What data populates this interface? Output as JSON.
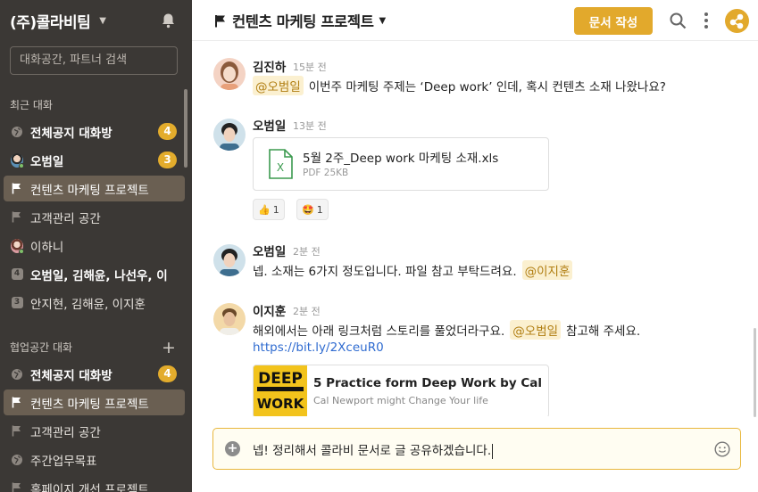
{
  "sidebar": {
    "workspace": "(주)콜라비팀",
    "search_placeholder": "대화공간, 파트너 검색",
    "recent_label": "최근 대화",
    "recent_items": [
      {
        "label": "전체공지 대화방",
        "icon": "globe-icon",
        "badge": "4",
        "bold": true
      },
      {
        "label": "오범일",
        "icon": "avatar",
        "badge": "3",
        "bold": true
      },
      {
        "label": "컨텐츠 마케팅 프로젝트",
        "icon": "flag-icon",
        "active": true
      },
      {
        "label": "고객관리 공간",
        "icon": "flag-icon"
      },
      {
        "label": "이하니",
        "icon": "avatar"
      },
      {
        "label": "오범일, 김해윤, 나선우, 이",
        "icon": "number-icon",
        "num": "4",
        "bold": true
      },
      {
        "label": "안지현, 김해윤, 이지훈",
        "icon": "number-icon",
        "num": "3"
      }
    ],
    "collab_label": "협업공간 대화",
    "collab_items": [
      {
        "label": "전체공지 대화방",
        "icon": "globe-icon",
        "badge": "4",
        "bold": true
      },
      {
        "label": "컨텐츠 마케팅 프로젝트",
        "icon": "flag-icon",
        "active": true
      },
      {
        "label": "고객관리 공간",
        "icon": "flag-icon"
      },
      {
        "label": "주간업무목표",
        "icon": "globe-icon"
      },
      {
        "label": "홈페이지 개선 프로젝트",
        "icon": "flag-icon"
      }
    ]
  },
  "header": {
    "title": "컨텐츠 마케팅 프로젝트",
    "write_button": "문서 작성"
  },
  "messages": [
    {
      "author": "김진하",
      "time": "15분 전",
      "mention": "@오범일",
      "text": "이번주 마케팅 주제는 ‘Deep work’ 인데, 혹시 컨텐츠 소재 나왔나요?"
    },
    {
      "author": "오범일",
      "time": "13분 전",
      "file": {
        "name": "5월 2주_Deep work 마케팅 소재.xls",
        "meta": "PDF  25KB"
      },
      "reactions": [
        {
          "emoji": "👍",
          "count": "1"
        },
        {
          "emoji": "🤩",
          "count": "1"
        }
      ]
    },
    {
      "author": "오범일",
      "time": "2분 전",
      "text": "넵. 소재는 6가지 정도입니다. 파일 참고 부탁드려요.",
      "mention": "@이지훈"
    },
    {
      "author": "이지훈",
      "time": "2분 전",
      "text": "해외에서는 아래 링크처럼 스토리를 풀었더라구요.",
      "mention": "@오범일",
      "text_after": "참고해 주세요.",
      "link": "https://bit.ly/2XceuR0",
      "preview": {
        "title": "5 Practice form Deep Work by Cal",
        "desc": "Cal Newport might Change Your life",
        "image_text": "DEEP WORK"
      }
    }
  ],
  "composer": {
    "text": "넵! 정리해서 콜라비 문서로 글 공유하겠습니다."
  },
  "colors": {
    "sidebar_bg": "#3b3835",
    "accent": "#e2a92c",
    "active_item": "#6a5f52",
    "link": "#2f6bd0"
  }
}
